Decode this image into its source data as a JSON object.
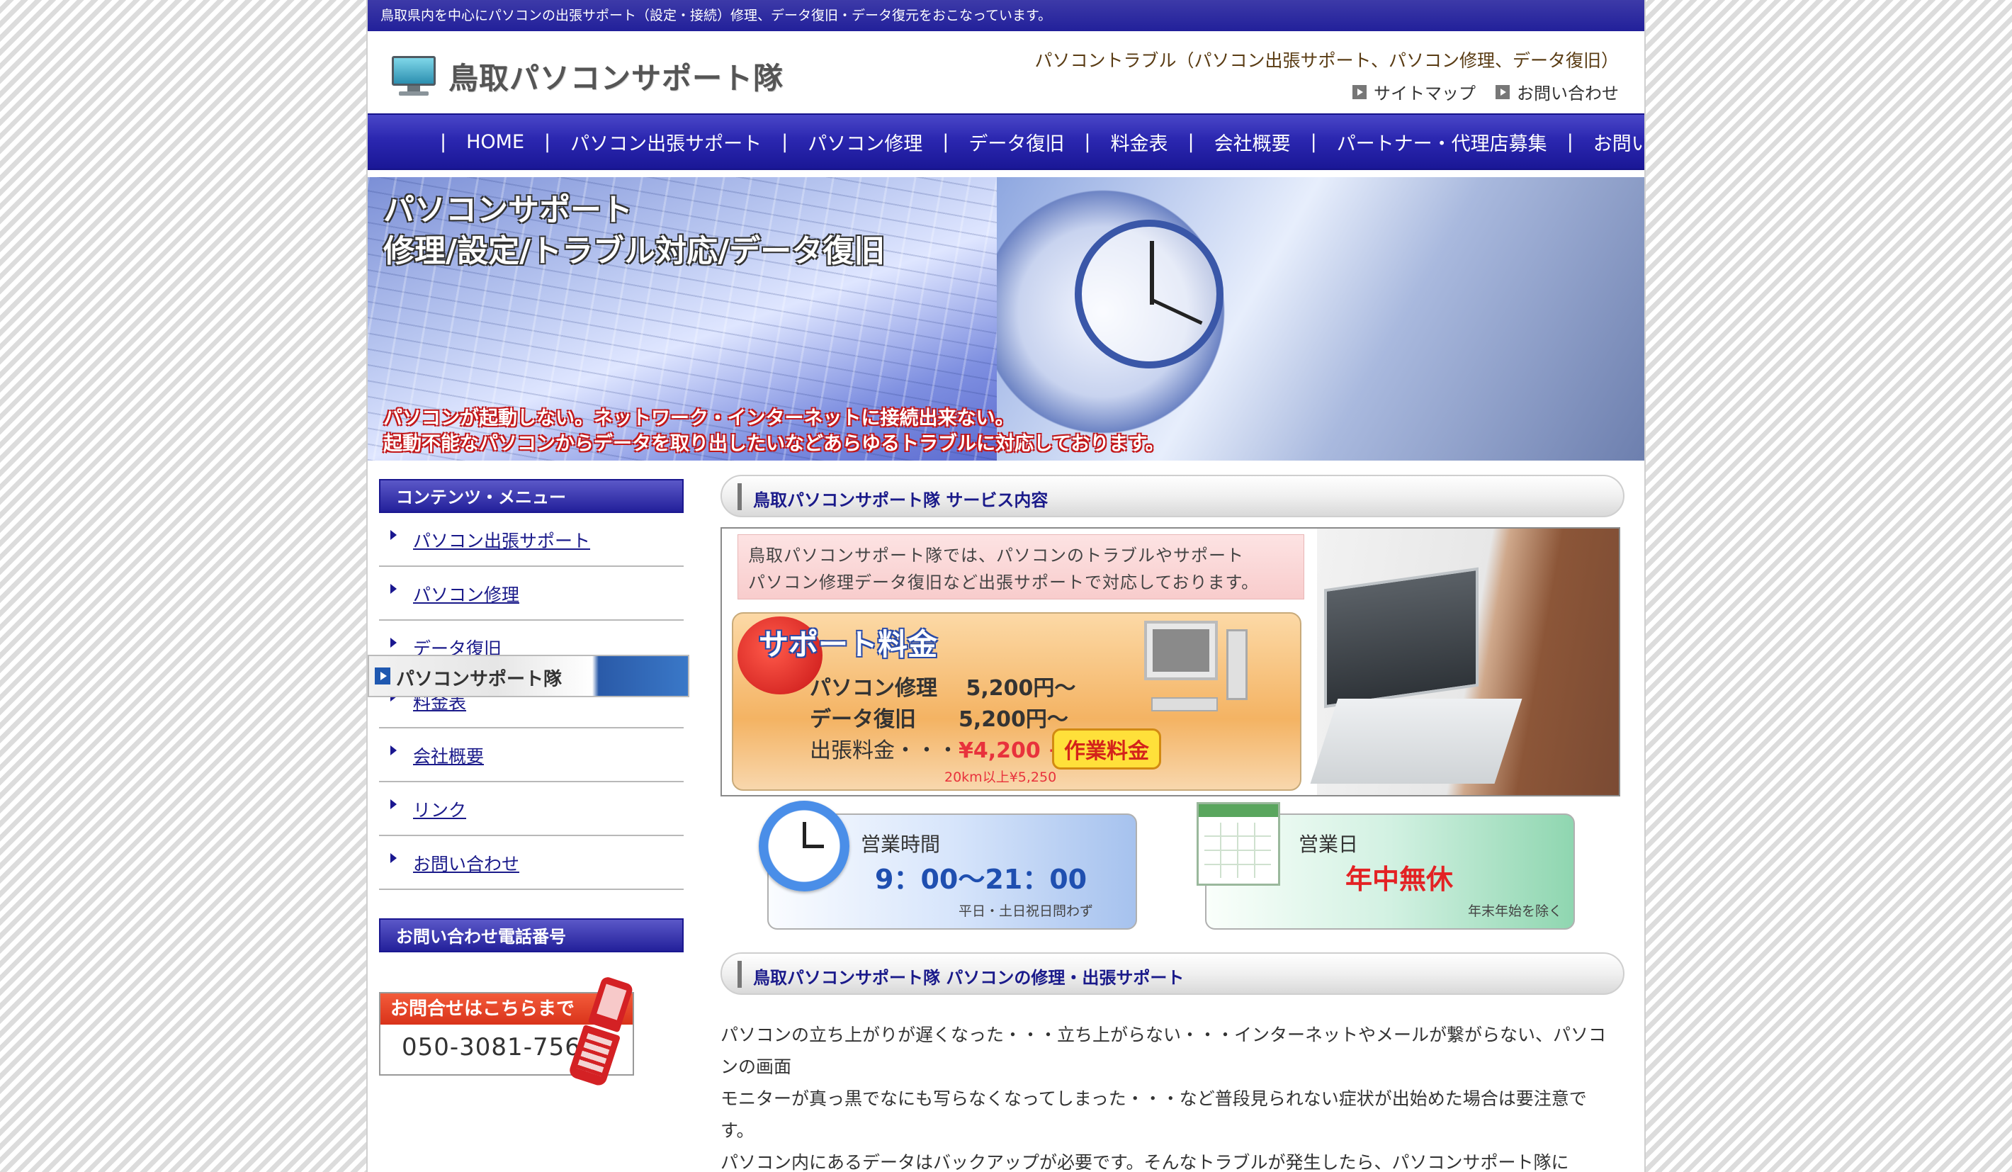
{
  "topbar": {
    "text": "鳥取県内を中心にパソコンの出張サポート（設定・接続）修理、データ復旧・データ復元をおこなっています。"
  },
  "header": {
    "logo": "鳥取パソコンサポート隊",
    "tagline": "パソコントラブル（パソコン出張サポート、パソコン修理、データ復旧）",
    "links": [
      "サイトマップ",
      "お問い合わせ"
    ]
  },
  "nav": {
    "separator": "|",
    "items": [
      "HOME",
      "パソコン出張サポート",
      "パソコン修理",
      "データ復旧",
      "料金表",
      "会社概要",
      "パートナー・代理店募集",
      "お問い合わ"
    ]
  },
  "hero": {
    "line1": "パソコンサポート",
    "line2": "修理/設定/トラブル対応/データ復旧",
    "red1": "パソコンが起動しない。ネットワーク・インターネットに接続出来ない。",
    "red2": "起動不能なパソコンからデータを取り出したいなどあらゆるトラブルに対応しております。"
  },
  "sidebar": {
    "menu_title": "コンテンツ・メニュー",
    "items": [
      "パソコン出張サポート",
      "パソコン修理",
      "データ復旧",
      "料金表",
      "会社概要",
      "リンク",
      "お問い合わせ"
    ],
    "phone_title": "お問い合わせ電話番号",
    "phone_head": "お問合せはこちらまで",
    "phone_number": "050-3081-7565",
    "banner2": "パソコンサポート隊"
  },
  "main": {
    "section1_title": "鳥取パソコンサポート隊 サービス内容",
    "note_line1": "鳥取パソコンサポート隊では、パソコンのトラブルやサポート",
    "note_line2": "パソコン修理データ復旧など出張サポートで対応しております。",
    "fee_title": "サポート料金",
    "fee_repair": "パソコン修理　 5,200円〜",
    "fee_recovery": "データ復旧　　5,200円〜",
    "fee_visit_label": "出張料金・・・",
    "fee_visit_price": "¥4,200 +",
    "fee_visit_sub": "20km以上¥5,250",
    "work_fee": "作業料金",
    "hours_label": "営業時間",
    "hours_value": "9：00〜21：00",
    "hours_note": "平日・土日祝日問わず",
    "days_label": "営業日",
    "days_value": "年中無休",
    "days_note": "年末年始を除く",
    "section2_title": "鳥取パソコンサポート隊 パソコンの修理・出張サポート",
    "para1": "パソコンの立ち上がりが遅くなった・・・立ち上がらない・・・インターネットやメールが繋がらない、パソコンの画面",
    "para2": "モニターが真っ黒でなにも写らなくなってしまった・・・など普段見られない症状が出始めた場合は要注意です。",
    "para3": "パソコン内にあるデータはバックアップが必要です。そんなトラブルが発生したら、パソコンサポート隊に"
  }
}
